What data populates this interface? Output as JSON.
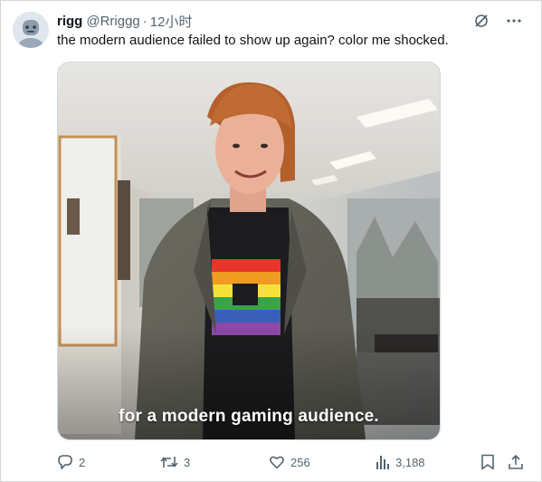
{
  "tweet": {
    "author_name": "rigg",
    "handle": "@Rriggg",
    "separator": "·",
    "time": "12小时",
    "text": "the modern audience failed to show up again? color me shocked.",
    "media_caption": "for a modern gaming audience."
  },
  "icons": {
    "avatar": "robot-avatar",
    "top_right": [
      "grok-icon",
      "more-icon"
    ],
    "actions": [
      "reply-icon",
      "retweet-icon",
      "like-icon",
      "views-icon",
      "bookmark-icon",
      "share-icon"
    ]
  },
  "actions": {
    "replies": "2",
    "retweets": "3",
    "likes": "256",
    "views": "3,188"
  },
  "colors": {
    "text": "#0f1419",
    "secondary": "#536471",
    "border": "#cfd9de"
  }
}
